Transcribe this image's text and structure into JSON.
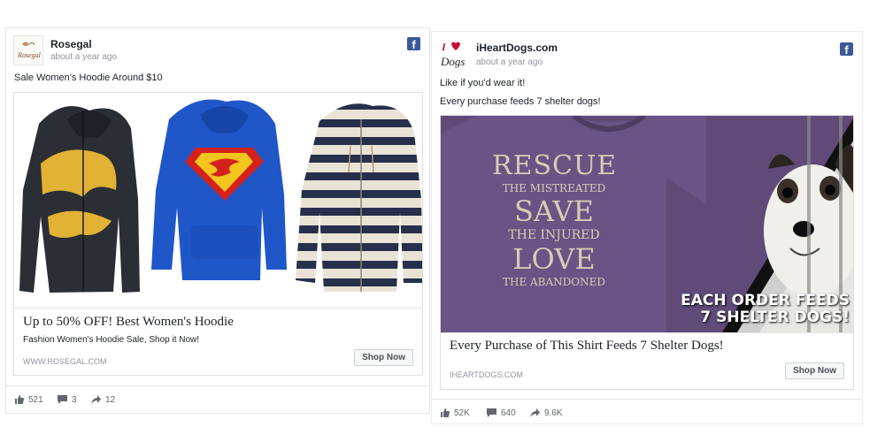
{
  "posts": [
    {
      "page_name": "Rosegal",
      "time": "about a year ago",
      "text": "Sale Women's Hoodie Around $10",
      "logo_text": "Rosegal",
      "card": {
        "title": "Up to 50% OFF! Best Women's Hoodie",
        "description": "Fashion Women's Hoodie Sale, Shop it Now!",
        "url": "WWW.ROSEGAL.COM",
        "button": "Shop Now"
      },
      "stats": {
        "likes": "521",
        "comments": "3",
        "shares": "12"
      }
    },
    {
      "page_name": "iHeartDogs.com",
      "time": "about a year ago",
      "text_lines": [
        "Like if you'd wear it!",
        "Every purchase feeds 7 shelter dogs!"
      ],
      "logo_text": "I ♥ Dogs",
      "image_text": {
        "shirt": [
          "RESCUE",
          "THE MISTREATED",
          "SAVE",
          "THE INJURED",
          "LOVE",
          "THE ABANDONED"
        ],
        "banner": [
          "EACH ORDER FEEDS",
          "7 SHELTER DOGS!"
        ]
      },
      "card": {
        "title": "Every Purchase of This Shirt Feeds 7 Shelter Dogs!",
        "url": "IHEARTDOGS.COM",
        "button": "Shop Now"
      },
      "stats": {
        "likes": "52K",
        "comments": "640",
        "shares": "9.6K"
      }
    }
  ],
  "icons": [
    "facebook-icon",
    "like-icon",
    "comment-icon",
    "share-icon"
  ],
  "colors": {
    "facebook_blue": "#3b5998",
    "shirt_purple": "#5f4a78",
    "hoodie_blue": "#1f57c9",
    "batman_yellow": "#e1b234"
  }
}
